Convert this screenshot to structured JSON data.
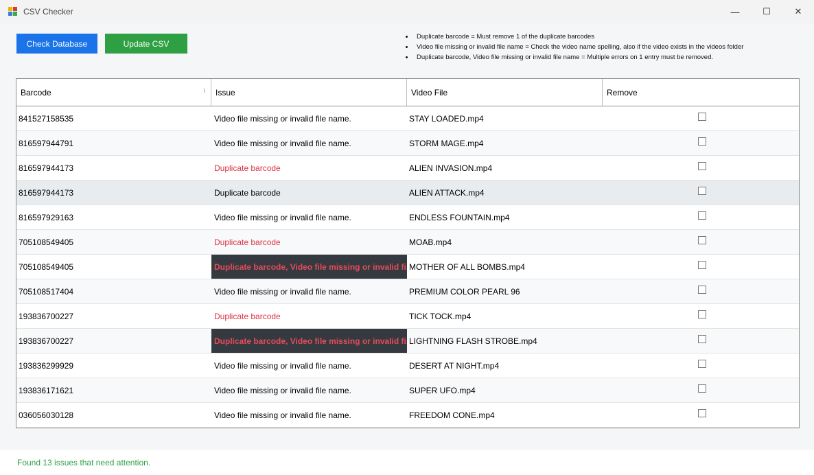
{
  "window": {
    "title": "CSV Checker",
    "icon": "app-icon",
    "controls": {
      "minimize": "—",
      "maximize": "☐",
      "close": "✕"
    }
  },
  "toolbar": {
    "check_label": "Check Database",
    "update_label": "Update CSV",
    "check_color": "#1a73e8",
    "update_color": "#2ea043"
  },
  "notes": [
    "Duplicate barcode = Must remove 1 of the duplicate barcodes",
    "Video file missing or invalid file name = Check the video name spelling, also if the video exists in the videos folder",
    "Duplicate barcode, Video file missing or invalid file name = Multiple errors on 1 entry must be removed."
  ],
  "grid": {
    "columns": [
      "Barcode",
      "Issue",
      "Video File",
      "Remove"
    ],
    "sort_glyph": "\\",
    "rows": [
      {
        "barcode": "841527158535",
        "issue": "Video file missing or invalid file name.",
        "video": "STAY LOADED.mp4",
        "style": ""
      },
      {
        "barcode": "816597944791",
        "issue": "Video file missing or invalid file name.",
        "video": "STORM MAGE.mp4",
        "style": ""
      },
      {
        "barcode": "816597944173",
        "issue": "Duplicate barcode",
        "video": "ALIEN INVASION.mp4",
        "style": "red"
      },
      {
        "barcode": "816597944173",
        "issue": "Duplicate barcode",
        "video": "ALIEN ATTACK.mp4",
        "style": "selected"
      },
      {
        "barcode": "816597929163",
        "issue": "Video file missing or invalid file name.",
        "video": "ENDLESS FOUNTAIN.mp4",
        "style": ""
      },
      {
        "barcode": "705108549405",
        "issue": "Duplicate barcode",
        "video": "MOAB.mp4",
        "style": "red"
      },
      {
        "barcode": "705108549405",
        "issue": "Duplicate barcode, Video file missing or invalid fi...",
        "video": "MOTHER OF ALL BOMBS.mp4",
        "style": "multi"
      },
      {
        "barcode": "705108517404",
        "issue": "Video file missing or invalid file name.",
        "video": "PREMIUM COLOR PEARL 96",
        "style": ""
      },
      {
        "barcode": "193836700227",
        "issue": "Duplicate barcode",
        "video": "TICK TOCK.mp4",
        "style": "red"
      },
      {
        "barcode": "193836700227",
        "issue": "Duplicate barcode, Video file missing or invalid fi...",
        "video": "LIGHTNING FLASH STROBE.mp4",
        "style": "multi"
      },
      {
        "barcode": "193836299929",
        "issue": "Video file missing or invalid file name.",
        "video": "DESERT AT NIGHT.mp4",
        "style": ""
      },
      {
        "barcode": "193836171621",
        "issue": "Video file missing or invalid file name.",
        "video": "SUPER UFO.mp4",
        "style": ""
      },
      {
        "barcode": "036056030128",
        "issue": "Video file missing or invalid file name.",
        "video": "FREEDOM CONE.mp4",
        "style": ""
      }
    ]
  },
  "status": {
    "text": "Found 13 issues that need attention.",
    "color": "#2ea043"
  }
}
